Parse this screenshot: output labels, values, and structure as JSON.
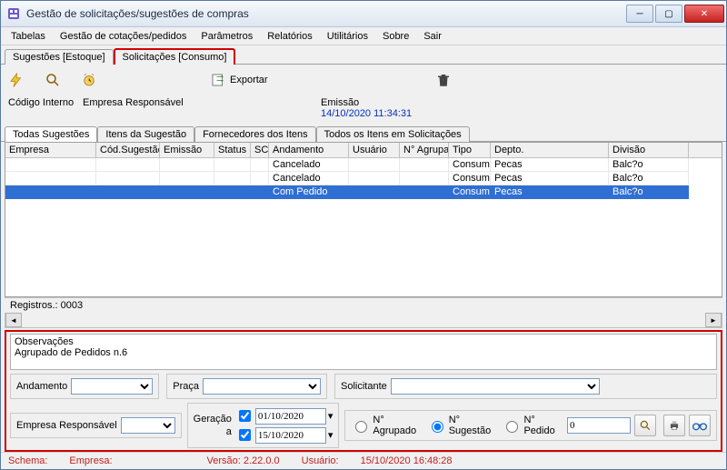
{
  "window": {
    "title": "Gestão de solicitações/sugestões de compras"
  },
  "menu": {
    "tabelas": "Tabelas",
    "cotacoes": "Gestão de cotações/pedidos",
    "parametros": "Parâmetros",
    "relatorios": "Relatórios",
    "utilitarios": "Utilitários",
    "sobre": "Sobre",
    "sair": "Sair"
  },
  "subtabs": {
    "estoque": "Sugestões [Estoque]",
    "consumo": "Solicitações [Consumo]"
  },
  "toolbar": {
    "exportar": "Exportar"
  },
  "info": {
    "codigo_lbl": "Código Interno",
    "empresa_lbl": "Empresa Responsável",
    "emissao_lbl": "Emissão",
    "emissao_val": "14/10/2020 11:34:31"
  },
  "gridtabs": {
    "todas": "Todas Sugestões",
    "itens": "Itens da Sugestão",
    "forn": "Fornecedores dos Itens",
    "todos": "Todos os Itens em Solicitações"
  },
  "cols": {
    "empresa": "Empresa",
    "cod": "Cód.Sugestão",
    "emissao": "Emissão",
    "status": "Status",
    "sc": "SC",
    "andamento": "Andamento",
    "usuario": "Usuário",
    "agrupado": "N° Agrupado",
    "tipo": "Tipo",
    "depto": "Depto.",
    "divisao": "Divisão"
  },
  "rows": [
    {
      "andamento": "Cancelado",
      "tipo": "Consumo",
      "depto": "Pecas",
      "divisao": "Balc?o",
      "sel": false
    },
    {
      "andamento": "Cancelado",
      "tipo": "Consumo",
      "depto": "Pecas",
      "divisao": "Balc?o",
      "sel": false
    },
    {
      "andamento": "Com Pedido",
      "tipo": "Consumo",
      "depto": "Pecas",
      "divisao": "Balc?o",
      "sel": true
    }
  ],
  "registros": "Registros.: 0003",
  "obs": {
    "label": "Observações",
    "text": "Agrupado de Pedidos n.6"
  },
  "filters": {
    "andamento": "Andamento",
    "praca": "Praça",
    "solicitante": "Solicitante",
    "empresa": "Empresa Responsável",
    "geracao": "Geração",
    "a": "a",
    "date1": "01/10/2020",
    "date2": "15/10/2020",
    "r_agrupado": "N° Agrupado",
    "r_sugestao": "N° Sugestão",
    "r_pedido": "N° Pedido",
    "num_val": "0"
  },
  "statusbar": {
    "schema": "Schema:",
    "empresa": "Empresa:",
    "versao": "Versão: 2.22.0.0",
    "usuario": "Usuário:",
    "data": "15/10/2020 16:48:28"
  }
}
